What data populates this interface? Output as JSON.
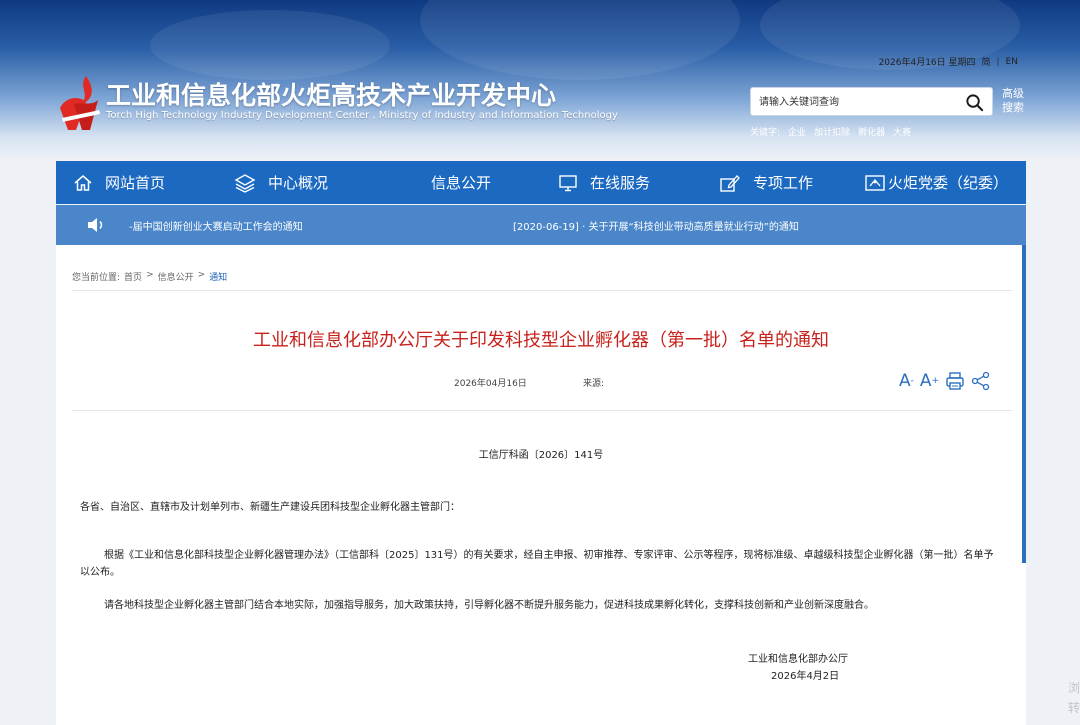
{
  "header": {
    "title": "工业和信息化部火炬高技术产业开发中心",
    "subtitle": "Torch High Technology Industry Development Center , Ministry of Industry and Information Technology",
    "date": "2026年4月16日 星期四",
    "lang_simplified": "简",
    "lang_en": "EN",
    "search_placeholder": "请输入关键词查询",
    "advanced_search": "高级搜索",
    "keywords_label": "关键字:",
    "keywords": [
      "企业",
      "加计扣除",
      "孵化器",
      "大赛"
    ]
  },
  "nav": {
    "items": [
      {
        "label": "网站首页",
        "icon": "home-icon"
      },
      {
        "label": "中心概况",
        "icon": "layers-icon"
      },
      {
        "label": "信息公开",
        "icon": ""
      },
      {
        "label": "在线服务",
        "icon": "monitor-icon"
      },
      {
        "label": "专项工作",
        "icon": "edit-icon"
      },
      {
        "label": "火炬党委（纪委）",
        "icon": "party-icon"
      }
    ],
    "bg_color": "#1c69c2"
  },
  "ticker": {
    "item1": "-届中国创新创业大赛启动工作会的通知",
    "item2": "[2020-06-19] · 关于开展“科技创业带动高质量就业行动”的通知"
  },
  "breadcrumb": {
    "label": "您当前位置:",
    "home": "首页",
    "sep": ">",
    "level1": "信息公开",
    "current": "通知"
  },
  "article": {
    "title": "工业和信息化部办公厅关于印发科技型企业孵化器（第一批）名单的通知",
    "date": "2026年04月16日",
    "source_label": "来源:",
    "doc_number": "工信厅科函〔2026〕141号",
    "salutation": "各省、自治区、直辖市及计划单列市、新疆生产建设兵团科技型企业孵化器主管部门：",
    "paragraphs": [
      "根据《工业和信息化部科技型企业孵化器管理办法》（工信部科〔2025〕131号）的有关要求，经自主申报、初审推荐、专家评审、公示等程序，现将标准级、卓越级科技型企业孵化器（第一批）名单予以公布。",
      "请各地科技型企业孵化器主管部门结合本地实际，加强指导服务，加大政策扶持，引导孵化器不断提升服务能力，促进科技成果孵化转化，支撑科技创新和产业创新深度融合。"
    ],
    "signature_org": "工业和信息化部办公厅",
    "signature_date": "2026年4月2日",
    "title_color": "#c8221c"
  },
  "float": {
    "line1": "浏",
    "line2": "转"
  }
}
